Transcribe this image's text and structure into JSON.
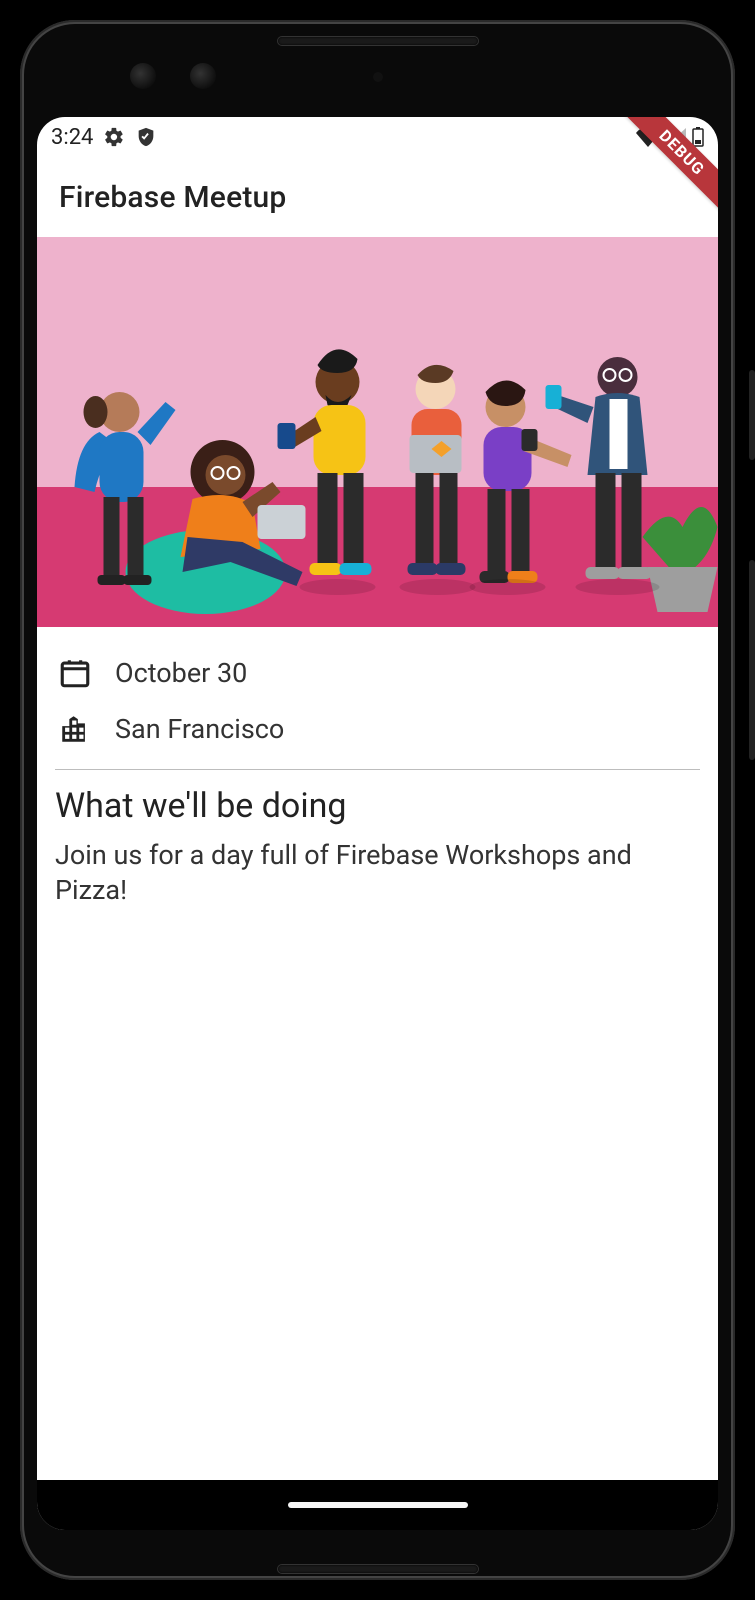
{
  "statusbar": {
    "time": "3:24"
  },
  "debug": {
    "label": "DEBUG"
  },
  "appbar": {
    "title": "Firebase Meetup"
  },
  "event": {
    "date": "October 30",
    "location": "San Francisco"
  },
  "section": {
    "heading": "What we'll be doing",
    "body": "Join us for a day full of Firebase Workshops and Pizza!"
  }
}
